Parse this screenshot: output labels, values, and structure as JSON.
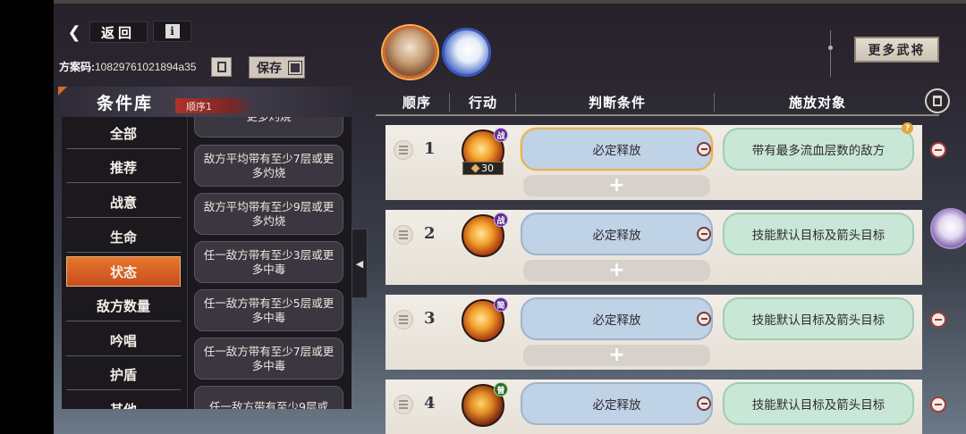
{
  "header": {
    "back_label": "返回",
    "info_label": "i",
    "plan_code_label": "方案码:",
    "plan_code_value": "10829761021894a35",
    "save_label": "保存",
    "more_generals_label": "更多武将"
  },
  "library": {
    "title": "条件库",
    "tag": "顺序1",
    "categories": [
      {
        "label": "全部"
      },
      {
        "label": "推荐"
      },
      {
        "label": "战意"
      },
      {
        "label": "生命"
      },
      {
        "label": "状态",
        "active": true
      },
      {
        "label": "敌方数量"
      },
      {
        "label": "吟唱"
      },
      {
        "label": "护盾"
      },
      {
        "label": "其他"
      }
    ],
    "conditions": [
      {
        "text": "更多灼烧"
      },
      {
        "text": "敌方平均带有至少7层或更多灼烧"
      },
      {
        "text": "敌方平均带有至少9层或更多灼烧"
      },
      {
        "text": "任一敌方带有至少3层或更多中毒"
      },
      {
        "text": "任一敌方带有至少5层或更多中毒"
      },
      {
        "text": "任一敌方带有至少7层或更多中毒"
      },
      {
        "text": "任一敌方带有至少9层或"
      }
    ]
  },
  "table": {
    "headers": {
      "order": "顺序",
      "action": "行动",
      "condition": "判断条件",
      "target": "施放对象"
    },
    "add_symbol": "+",
    "help_symbol": "?",
    "rows": [
      {
        "num": "1",
        "badge": "战",
        "count": "30",
        "condition": "必定释放",
        "target": "带有最多流血层数的敌方"
      },
      {
        "num": "2",
        "badge": "战",
        "condition": "必定释放",
        "target": "技能默认目标及箭头目标"
      },
      {
        "num": "3",
        "badge": "简",
        "condition": "必定释放",
        "target": "技能默认目标及箭头目标"
      },
      {
        "num": "4",
        "badge": "普",
        "condition": "必定释放",
        "target": "技能默认目标及箭头目标"
      }
    ]
  },
  "colors": {
    "accent_orange": "#e6762c",
    "condition_blue": "#bfd2e6",
    "target_green": "#c9e7d6",
    "delete_red": "#a33c3c"
  }
}
